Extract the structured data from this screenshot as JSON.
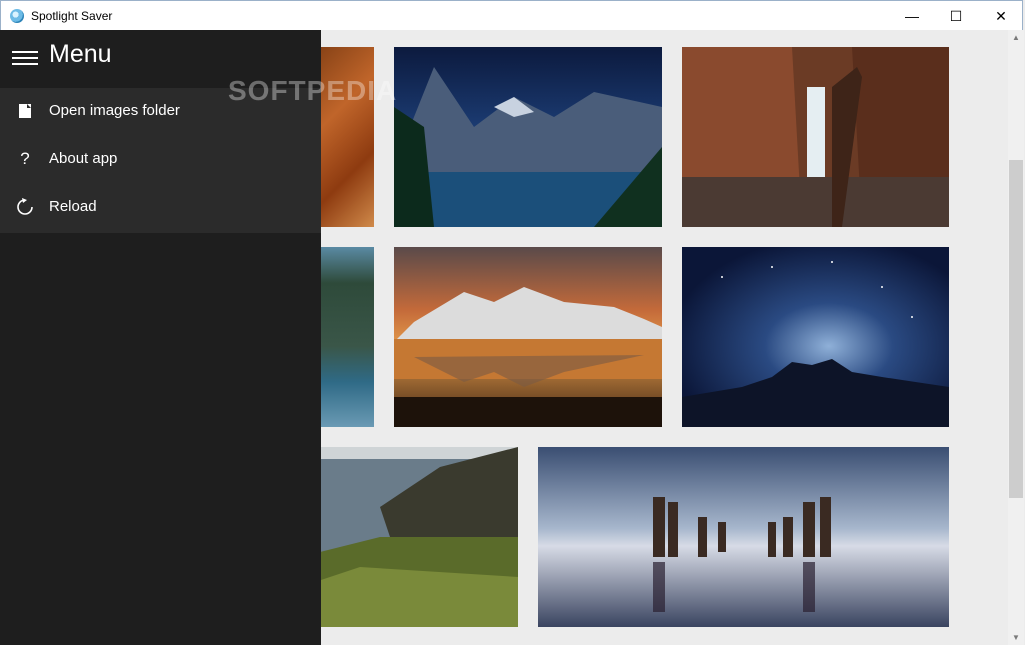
{
  "window": {
    "title": "Spotlight Saver"
  },
  "window_controls": {
    "minimize": "—",
    "maximize": "☐",
    "close": "✕"
  },
  "menu": {
    "title": "Menu",
    "items": [
      {
        "label": "Open images folder",
        "icon": "folder-icon"
      },
      {
        "label": "About app",
        "icon": "help-icon"
      },
      {
        "label": "Reload",
        "icon": "reload-icon"
      }
    ]
  },
  "watermark": "SOFTPEDIA",
  "gallery": {
    "images": [
      {
        "subject": "red canyon rock"
      },
      {
        "subject": "mountain lake under starry night"
      },
      {
        "subject": "canyon waterfall with ladder"
      },
      {
        "subject": "sea cliff and water"
      },
      {
        "subject": "snowy mountains reflected at sunset"
      },
      {
        "subject": "milky way over mountain silhouette"
      },
      {
        "subject": "coastal cliffs with grass"
      },
      {
        "subject": "wooden pier posts in calm water"
      }
    ]
  }
}
